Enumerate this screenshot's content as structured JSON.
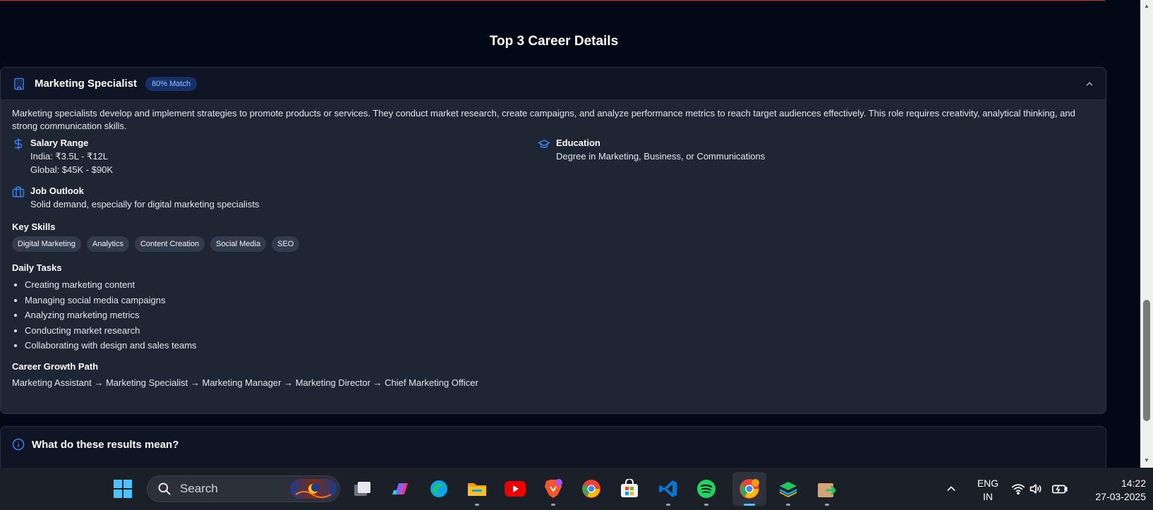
{
  "section_title": "Top 3 Career Details",
  "career": {
    "title": "Marketing Specialist",
    "match": "80% Match",
    "description": "Marketing specialists develop and implement strategies to promote products or services. They conduct market research, create campaigns, and analyze performance metrics to reach target audiences effectively. This role requires creativity, analytical thinking, and strong communication skills.",
    "salary": {
      "label": "Salary Range",
      "india": "India: ₹3.5L - ₹12L",
      "global": "Global: $45K - $90K"
    },
    "education": {
      "label": "Education",
      "text": "Degree in Marketing, Business, or Communications"
    },
    "outlook": {
      "label": "Job Outlook",
      "text": "Solid demand, especially for digital marketing specialists"
    },
    "skills_title": "Key Skills",
    "skills": [
      "Digital Marketing",
      "Analytics",
      "Content Creation",
      "Social Media",
      "SEO"
    ],
    "tasks_title": "Daily Tasks",
    "tasks": [
      "Creating marketing content",
      "Managing social media campaigns",
      "Analyzing marketing metrics",
      "Conducting market research",
      "Collaborating with design and sales teams"
    ],
    "growth_title": "Career Growth Path",
    "growth_path": "Marketing Assistant → Marketing Specialist → Marketing Manager → Marketing Director → Chief Marketing Officer"
  },
  "results_card": {
    "title": "What do these results mean?"
  },
  "taskbar": {
    "search_placeholder": "Search",
    "language": "ENG",
    "region": "IN",
    "time": "14:22",
    "date": "27-03-2025",
    "apps": [
      "start-icon",
      "task-view-icon",
      "copilot-icon",
      "edge-icon",
      "file-explorer-icon",
      "youtube-icon",
      "brave-icon",
      "chrome-icon",
      "microsoft-store-icon",
      "vscode-icon",
      "spotify-icon",
      "chrome-canary-icon",
      "layers-app-icon",
      "share-app-icon"
    ]
  },
  "colors": {
    "background": "#030817",
    "card": "#1e2533",
    "accent": "#3b82f6",
    "badge": "#17306a"
  }
}
